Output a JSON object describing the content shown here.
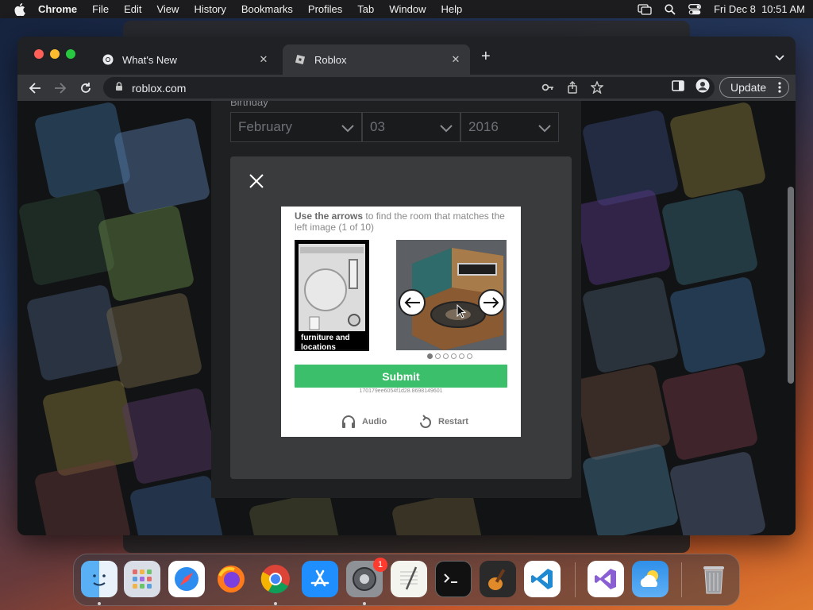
{
  "menubar": {
    "app_name": "Chrome",
    "items": [
      "File",
      "Edit",
      "View",
      "History",
      "Bookmarks",
      "Profiles",
      "Tab",
      "Window",
      "Help"
    ],
    "datetime": "Fri Dec 8  10:51 AM"
  },
  "browser": {
    "tabs": [
      {
        "label": "What's New",
        "icon": "chrome-icon",
        "active": false
      },
      {
        "label": "Roblox",
        "icon": "roblox-icon",
        "active": true
      }
    ],
    "url": "roblox.com",
    "update_label": "Update"
  },
  "signup": {
    "birthday_label": "Birthday",
    "month": "February",
    "day": "03",
    "year": "2016"
  },
  "captcha": {
    "instruction_bold": "Use the arrows",
    "instruction_rest": " to find the room that matches the left image (1 of 10)",
    "reference_caption": "furniture and locations",
    "submit_label": "Submit",
    "session_id": "170179ee6054f1d28.8698149601",
    "audio_label": "Audio",
    "restart_label": "Restart",
    "page_dots": 6,
    "active_dot": 0
  },
  "dock": {
    "apps": [
      "finder-icon",
      "launchpad-icon",
      "safari-icon",
      "firefox-icon",
      "chrome-icon",
      "app-store-icon",
      "system-settings-icon",
      "textedit-icon",
      "terminal-icon",
      "garageband-icon",
      "vscode-icon",
      "visual-studio-icon",
      "weather-icon",
      "trash-icon"
    ],
    "settings_badge": "1"
  },
  "colors": {
    "submit_green": "#3cbf6a",
    "modal_bg": "#393b3d",
    "browser_dark": "#202124"
  }
}
